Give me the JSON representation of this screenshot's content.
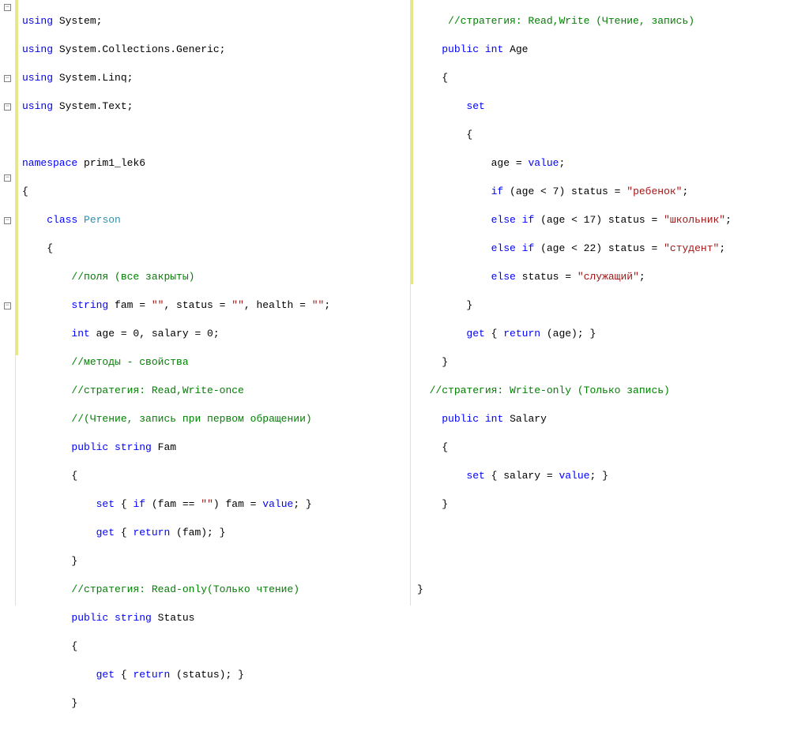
{
  "left": {
    "usings": [
      {
        "kw": "using",
        "ns": "System"
      },
      {
        "kw": "using",
        "ns": "System.Collections.Generic"
      },
      {
        "kw": "using",
        "ns": "System.Linq"
      },
      {
        "kw": "using",
        "ns": "System.Text"
      }
    ],
    "namespace_kw": "namespace",
    "namespace_name": "prim1_lek6",
    "class_kw": "class",
    "class_name": "Person",
    "comment_fields": "//поля (все закрыты)",
    "field_string_kw": "string",
    "field_string_decl": " fam = ",
    "empty_str": "\"\"",
    "field_status": ", status = ",
    "field_health": ", health = ",
    "semicolon": ";",
    "field_int_kw": "int",
    "field_int_decl": " age = 0, salary = 0;",
    "comment_methods": "//методы - свойства",
    "comment_strat1": "//стратегия: Read,Write-once",
    "comment_strat1b": "//(Чтение, запись при первом обращении)",
    "public_kw": "public",
    "string_kw": "string",
    "fam_prop": "Fam",
    "set_kw": "set",
    "if_kw": "if",
    "fam_check": " (fam == ",
    "fam_assign": ") fam = ",
    "value_kw": "value",
    "get_kw": "get",
    "return_kw": "return",
    "return_fam": " (fam); }",
    "comment_strat2": "//стратегия: Read-only(Только чтение)",
    "status_prop": "Status",
    "return_status": " (status); }",
    "brace_open": "{",
    "brace_close": "}"
  },
  "right": {
    "comment_strat3": "//стратегия: Read,Write (Чтение, запись)",
    "public_kw": "public",
    "int_kw": "int",
    "age_prop": "Age",
    "brace_open": "{",
    "brace_close": "}",
    "set_kw": "set",
    "age_assign": "age = ",
    "value_kw": "value",
    "semicolon": ";",
    "if_kw": "if",
    "age_lt7": " (age < 7) status = ",
    "str_child": "\"ребенок\"",
    "else_kw": "else",
    "age_lt17": " (age < 17) status = ",
    "str_school": "\"школьник\"",
    "age_lt22": " (age < 22) status = ",
    "str_student": "\"студент\"",
    "else_status": " status = ",
    "str_employee": "\"служащий\"",
    "get_kw": "get",
    "return_kw": "return",
    "return_age": " (age); }",
    "comment_strat4": "//стратегия: Write-only (Только запись)",
    "salary_prop": "Salary",
    "salary_assign": " { salary = "
  }
}
